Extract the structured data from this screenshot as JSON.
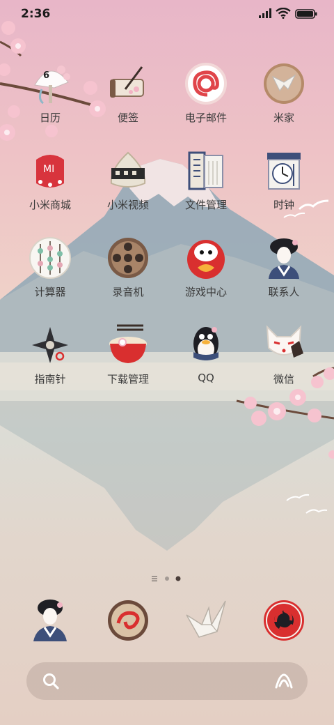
{
  "status_bar": {
    "time": "2:36"
  },
  "apps": [
    {
      "label": "日历",
      "icon": "calendar-fan-icon",
      "badge": "6"
    },
    {
      "label": "便签",
      "icon": "notes-scroll-icon"
    },
    {
      "label": "电子邮件",
      "icon": "email-at-icon"
    },
    {
      "label": "米家",
      "icon": "mijia-origami-icon"
    },
    {
      "label": "小米商城",
      "icon": "mi-store-amulet-icon"
    },
    {
      "label": "小米视频",
      "icon": "video-onigiri-icon"
    },
    {
      "label": "文件管理",
      "icon": "file-scroll-icon"
    },
    {
      "label": "时钟",
      "icon": "clock-scroll-icon"
    },
    {
      "label": "计算器",
      "icon": "abacus-icon"
    },
    {
      "label": "录音机",
      "icon": "film-reel-icon"
    },
    {
      "label": "游戏中心",
      "icon": "daruma-icon"
    },
    {
      "label": "联系人",
      "icon": "geisha-icon"
    },
    {
      "label": "指南针",
      "icon": "shuriken-compass-icon"
    },
    {
      "label": "下载管理",
      "icon": "ramen-bowl-icon"
    },
    {
      "label": "QQ",
      "icon": "qq-penguin-icon"
    },
    {
      "label": "微信",
      "icon": "fox-mask-icon"
    }
  ],
  "page_indicator": {
    "count": 3,
    "active": 3
  },
  "dock": [
    {
      "icon": "geisha-phone-icon"
    },
    {
      "icon": "naruto-swirl-icon"
    },
    {
      "icon": "paper-crane-icon"
    },
    {
      "icon": "tomoe-icon"
    }
  ],
  "search_bar": {
    "left_icon": "search-icon",
    "right_icon": "assistant-icon"
  }
}
